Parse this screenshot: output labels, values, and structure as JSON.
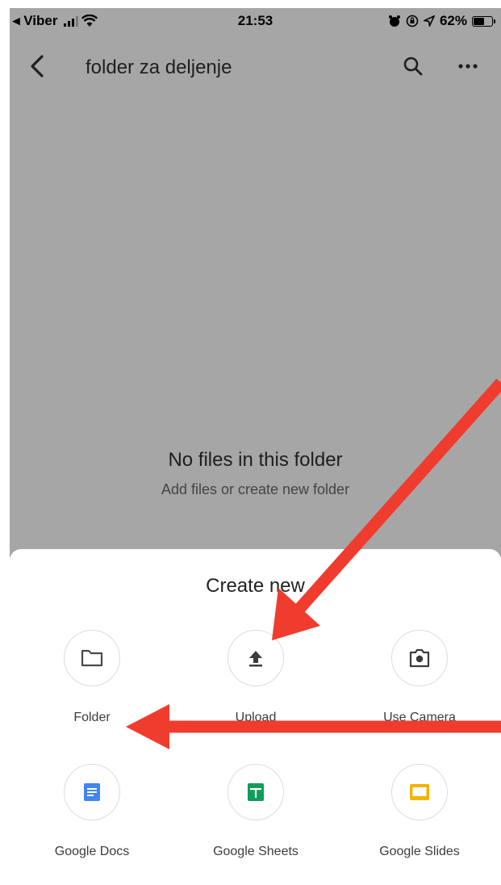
{
  "status_bar": {
    "back_app": "◂ Viber",
    "time": "21:53",
    "battery_percent": "62%",
    "battery_level": 0.62,
    "icons": [
      "signal-icon",
      "wifi-icon",
      "alarm-icon",
      "orientation-lock-icon",
      "location-icon",
      "battery-icon"
    ]
  },
  "header": {
    "title": "folder za deljenje",
    "back_icon": "chevron-left-icon",
    "search_icon": "search-icon",
    "more_icon": "more-horizontal-icon"
  },
  "empty_state": {
    "title": "No files in this folder",
    "subtitle": "Add files or create new folder"
  },
  "sheet": {
    "title": "Create new",
    "options": [
      {
        "label": "Folder",
        "icon": "folder-icon"
      },
      {
        "label": "Upload",
        "icon": "upload-icon"
      },
      {
        "label": "Use Camera",
        "icon": "camera-icon"
      },
      {
        "label": "Google Docs",
        "icon": "google-docs-icon",
        "color": "#4285f4"
      },
      {
        "label": "Google Sheets",
        "icon": "google-sheets-icon",
        "color": "#0f9d58"
      },
      {
        "label": "Google Slides",
        "icon": "google-slides-icon",
        "color": "#f4b400"
      }
    ]
  },
  "colors": {
    "overlay": "#a6a6a6",
    "annotation_arrow": "#f03c2e",
    "icon_gray": "#5f6368"
  }
}
